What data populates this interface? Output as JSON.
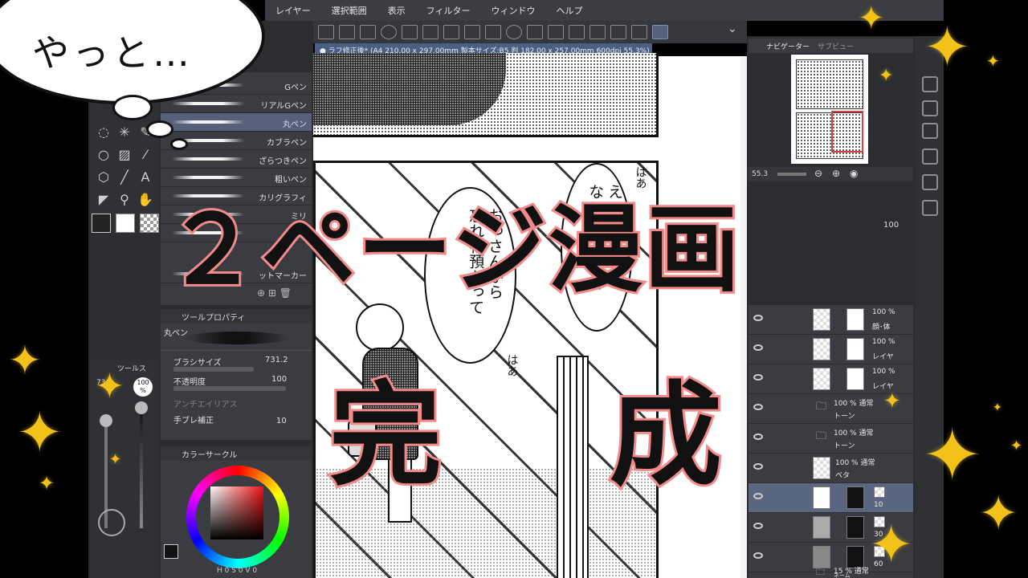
{
  "menu": [
    "レイヤー",
    "選択範囲",
    "表示",
    "フィルター",
    "ウィンドウ",
    "ヘルプ"
  ],
  "document_tab": "● ラフ修正後* (A4 210.00 x 297.00mm 製本サイズ:B5 判 182.00 x 257.00mm 600dpi 55.3%)",
  "brushes": [
    "Gペン",
    "リアルGペン",
    "丸ペン",
    "カブラペン",
    "ざらつきペン",
    "粗いペン",
    "カリグラフィ",
    "ミリ",
    "サ",
    "ットマーカー"
  ],
  "selected_brush_index": 2,
  "tool_property": {
    "header": "ツールプロパティ",
    "tool_name": "丸ペン",
    "brush_size_label": "ブラシサイズ",
    "brush_size_value": "731.2",
    "opacity_label": "不透明度",
    "opacity_value": "100",
    "antialias_label": "アンチエイリアス",
    "stabilization_label": "手ブレ補正",
    "stabilization_value": "10"
  },
  "tool_palette_title": "ツールス",
  "size_opacity": {
    "size_value": "73",
    "opacity_value": "100",
    "opacity_unit": "%"
  },
  "color_panel": {
    "header": "カラーサークル",
    "hsv_readout": "H 0 S 0 V 0"
  },
  "navigator": {
    "tab_active": "ナビゲーター",
    "tab_inactive": "サブビュー",
    "zoom": "55.3"
  },
  "layer_opacity_value": "100",
  "layers": [
    {
      "pct": "100 %",
      "name": "顔･体",
      "selected": false
    },
    {
      "pct": "100 %",
      "name": "レイヤ",
      "selected": false
    },
    {
      "pct": "100 %",
      "name": "レイヤ",
      "selected": false
    },
    {
      "pct": "100 % 通常",
      "name": "トーン",
      "selected": false,
      "folder": true
    },
    {
      "pct": "100 % 通常",
      "name": "トーン",
      "selected": false,
      "folder": true
    },
    {
      "pct": "100 % 通常",
      "name": "ベタ",
      "selected": false
    },
    {
      "pct": "10",
      "name": "",
      "selected": true
    },
    {
      "pct": "30",
      "name": "",
      "selected": false
    },
    {
      "pct": "60",
      "name": "",
      "selected": false
    },
    {
      "pct": "15 % 通常",
      "name": "ネーム",
      "selected": false,
      "folder": true
    }
  ],
  "manga": {
    "bubble_left_text": [
      "おっ",
      "さんから",
      "忘れ物預かって"
    ],
    "bubble_right_text": [
      "えって",
      "に",
      "ないから",
      "よくて"
    ],
    "sfx_1": "はあ",
    "sfx_2": "はあ"
  },
  "overlay": {
    "thought_text": "やっと…",
    "title_line1": "２ページ漫画",
    "title_line2": "完 成"
  },
  "colors": {
    "title_fill": "#111111",
    "title_outline": "#f28a8a",
    "sparkle": "#f2c21b",
    "ui_dark": "#2b2d31",
    "ui_panel": "#3a3c41",
    "selection": "#56607a"
  }
}
